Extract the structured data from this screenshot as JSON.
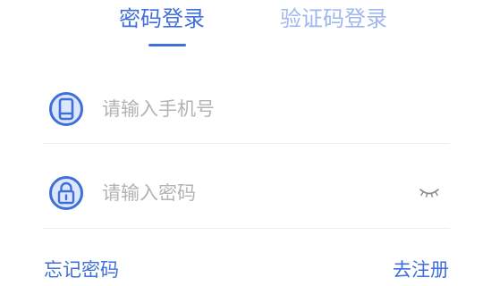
{
  "tabs": {
    "password_login": "密码登录",
    "sms_login": "验证码登录",
    "active": "password_login"
  },
  "phone_field": {
    "placeholder": "请输入手机号",
    "value": "",
    "icon": "phone-icon"
  },
  "password_field": {
    "placeholder": "请输入密码",
    "value": "",
    "icon": "lock-icon",
    "toggle_icon": "eye-closed-icon"
  },
  "links": {
    "forgot_password": "忘记密码",
    "register": "去注册"
  },
  "colors": {
    "accent": "#3f6fd8",
    "accent_light": "#9fb7ee",
    "placeholder": "#b3b3b3",
    "divider": "#ececec",
    "icon_fill": "#dce7fb"
  }
}
